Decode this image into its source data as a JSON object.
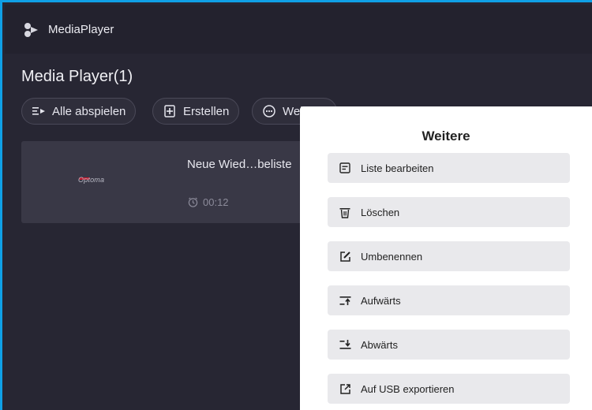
{
  "app": {
    "name": "MediaPlayer"
  },
  "page": {
    "title": "Media Player(1)"
  },
  "toolbar": {
    "play_all": "Alle abspielen",
    "create": "Erstellen",
    "more": "Weitere"
  },
  "playlist": {
    "title": "Neue Wied…beliste",
    "duration": "00:12",
    "thumbnail_brand": "Optoma"
  },
  "menu": {
    "title": "Weitere",
    "items": [
      {
        "label": "Liste bearbeiten",
        "icon": "edit-list-icon"
      },
      {
        "label": "Löschen",
        "icon": "trash-icon"
      },
      {
        "label": "Umbenennen",
        "icon": "rename-icon"
      },
      {
        "label": "Aufwärts",
        "icon": "move-up-icon"
      },
      {
        "label": "Abwärts",
        "icon": "move-down-icon"
      },
      {
        "label": "Auf USB exportieren",
        "icon": "export-usb-icon"
      }
    ]
  },
  "colors": {
    "accent_border": "#0fa0e6",
    "background": "#272633",
    "card": "#393846",
    "brand_red": "#c2182b"
  }
}
